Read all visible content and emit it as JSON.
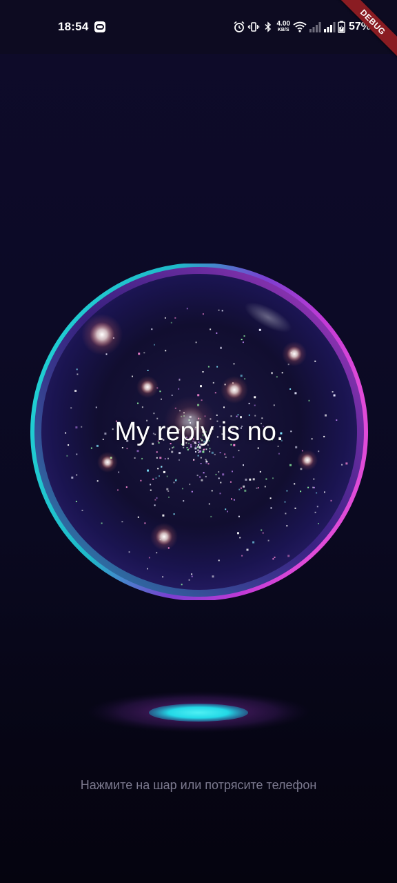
{
  "status_bar": {
    "time": "18:54",
    "net_speed_value": "4.00",
    "net_speed_unit": "KB/S",
    "battery_percent": "57%",
    "icons": [
      "app-notification-icon",
      "alarm-icon",
      "vibrate-icon",
      "bluetooth-icon",
      "wifi-icon",
      "signal-icon",
      "signal-icon",
      "battery-charging-icon"
    ]
  },
  "debug_banner": {
    "label": "DEBUG"
  },
  "orb": {
    "answer": "My reply is no.",
    "colors": {
      "rim_teal": "#22d3d6",
      "rim_magenta": "#c23ad6",
      "core": "#0c0a26"
    }
  },
  "hint": {
    "text": "Нажмите на шар или потрясите телефон"
  },
  "colors": {
    "background": "#0c0a26",
    "shadow_glow": "#23d8e6",
    "shadow_halo": "#b03ad0"
  }
}
